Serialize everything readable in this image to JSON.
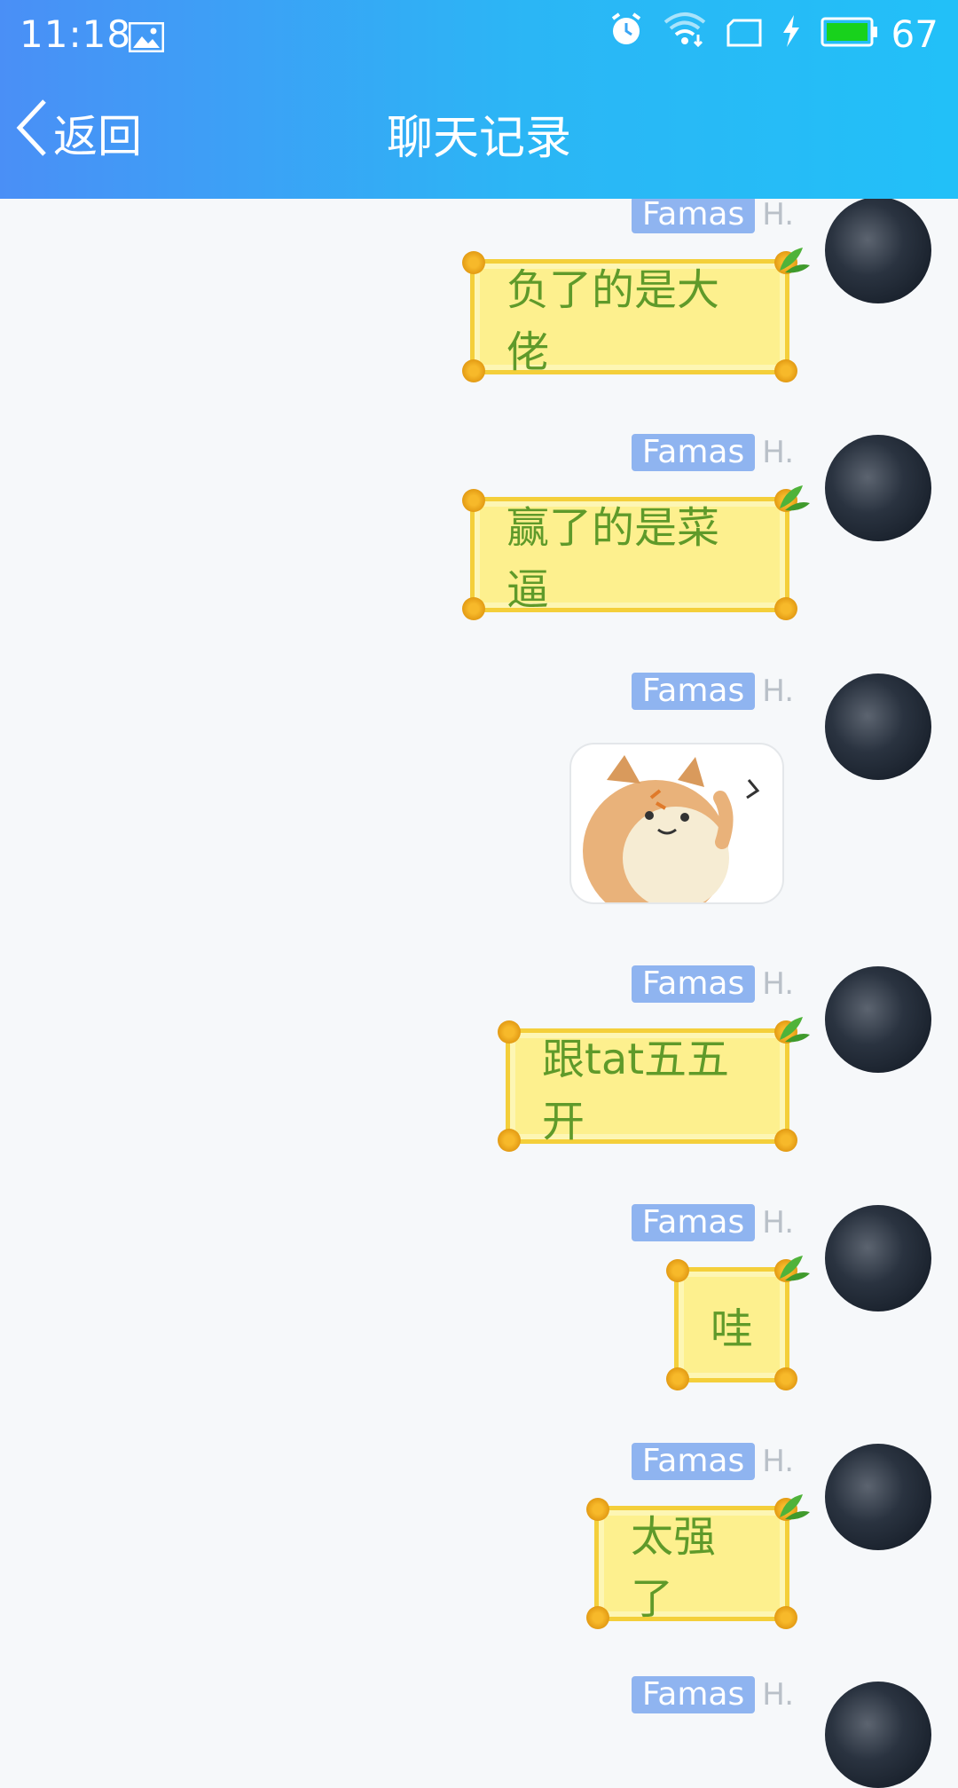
{
  "status_bar": {
    "time": "11:18",
    "battery_level": "67",
    "battery_fill_percent": 67,
    "icons": [
      "image-icon",
      "alarm-icon",
      "wifi-icon",
      "screen-cast-icon",
      "charging-icon",
      "battery-icon"
    ]
  },
  "nav": {
    "back_label": "返回",
    "title": "聊天记录"
  },
  "colors": {
    "header_start": "#4a8ff6",
    "header_end": "#22c0f8",
    "bubble_fill": "#fdf08e",
    "bubble_text": "#5f9a2a",
    "nick_badge": "#8fb4f0"
  },
  "messages": [
    {
      "sender": "Famas",
      "sender_suffix": "H.",
      "type": "text",
      "text": "负了的是大佬"
    },
    {
      "sender": "Famas",
      "sender_suffix": "H.",
      "type": "text",
      "text": "赢了的是菜逼"
    },
    {
      "sender": "Famas",
      "sender_suffix": "H.",
      "type": "sticker",
      "sticker": "shiba-dog-sticker"
    },
    {
      "sender": "Famas",
      "sender_suffix": "H.",
      "type": "text",
      "text": "跟tat五五开"
    },
    {
      "sender": "Famas",
      "sender_suffix": "H.",
      "type": "text",
      "text": "哇"
    },
    {
      "sender": "Famas",
      "sender_suffix": "H.",
      "type": "text",
      "text": "太强了"
    },
    {
      "sender": "Famas",
      "sender_suffix": "H.",
      "type": "partial"
    }
  ]
}
